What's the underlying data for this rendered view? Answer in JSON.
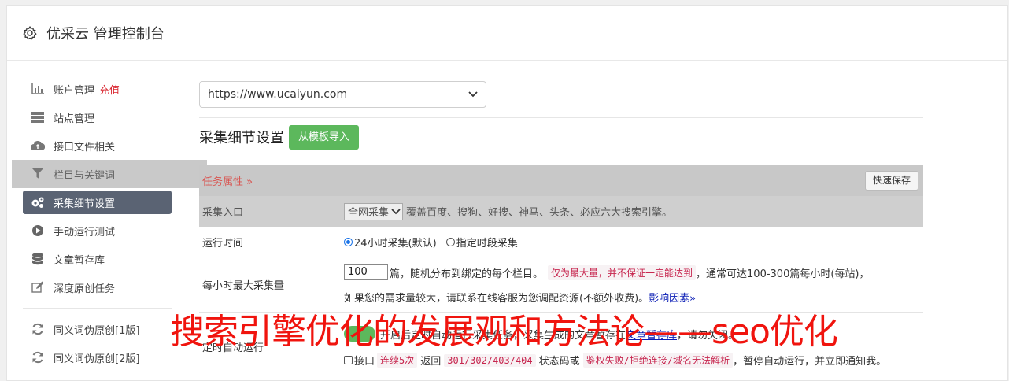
{
  "header": {
    "icon": "gear-icon",
    "title": "优采云 管理控制台"
  },
  "sidebar": {
    "items": [
      {
        "icon": "bar-chart-icon",
        "label": "账户管理",
        "badge": "充值"
      },
      {
        "icon": "server-icon",
        "label": "站点管理"
      },
      {
        "icon": "cloud-upload-icon",
        "label": "接口文件相关"
      },
      {
        "icon": "filter-icon",
        "label": "栏目与关键词"
      },
      {
        "icon": "gears-icon",
        "label": "采集细节设置"
      },
      {
        "icon": "play-circle-icon",
        "label": "手动运行测试"
      },
      {
        "icon": "database-icon",
        "label": "文章暂存库"
      },
      {
        "icon": "edit-icon",
        "label": "深度原创任务"
      },
      {
        "icon": "refresh-icon",
        "label": "同义词伪原创[1版]"
      },
      {
        "icon": "refresh-icon",
        "label": "同义词伪原创[2版]"
      }
    ]
  },
  "main": {
    "site_select": "https://www.ucaiyun.com",
    "section_title": "采集细节设置",
    "import_button": "从模板导入",
    "task_attr": "任务属性 »",
    "quick_save": "快速保存",
    "rows": {
      "entry": {
        "label": "采集入口",
        "select": "全网采集",
        "desc": "覆盖百度、搜狗、好搜、神马、头条、必应六大搜索引擎。"
      },
      "time": {
        "label": "运行时间",
        "opt1": "24小时采集(默认)",
        "opt2": "指定时段采集"
      },
      "max": {
        "label": "每小时最大采集量",
        "value": "100",
        "t1": "篇，随机分布到绑定的每个栏目。",
        "code": "仅为最大量，并不保证一定能达到",
        "t2": "，通常可达100-300篇每小时(每站)，",
        "t3": "如果您的需求量较大，请联系在线客服为您调配资源(不额外收费)。",
        "link": "影响因素»"
      },
      "auto": {
        "label": "定时自动运行",
        "t1": "开启后定时自动运行采集任务，采集生成的文章暂存在",
        "link": "文章暂存库",
        "t2": "，请勿关闭。",
        "chk_label": "接口",
        "code1": "连续5次",
        "t3": "返回",
        "code2": "301/302/403/404",
        "t4": "状态码或",
        "code3": "鉴权失败/拒绝连接/域名无法解析",
        "t5": "，暂停自动运行，并立即通知我。"
      }
    }
  },
  "overlay_text": "搜索引擎优化的发展观和方法论——seo优化"
}
